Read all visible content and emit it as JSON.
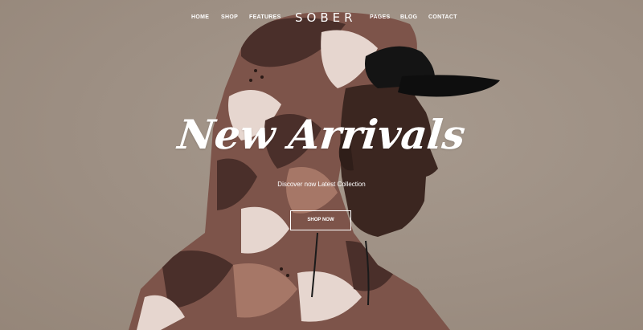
{
  "brand": {
    "logo_text": "SOBER"
  },
  "nav": {
    "items": [
      {
        "label": "HOME"
      },
      {
        "label": "SHOP"
      },
      {
        "label": "FEATURES"
      },
      {
        "label": "PAGES"
      },
      {
        "label": "BLOG"
      },
      {
        "label": "CONTACT"
      }
    ]
  },
  "hero": {
    "title": "New Arrivals",
    "subtitle": "Discover now Latest Collection",
    "cta_label": "SHOP NOW",
    "image_subject": "man-in-camo-hooded-jacket-and-black-cap"
  },
  "colors": {
    "background": "#a09286",
    "text": "#ffffff",
    "jacket_dark": "#4a2f2a",
    "jacket_mid": "#8a5f52",
    "jacket_light": "#e6d6cf",
    "skin": "#3b2620",
    "cap": "#141414"
  }
}
